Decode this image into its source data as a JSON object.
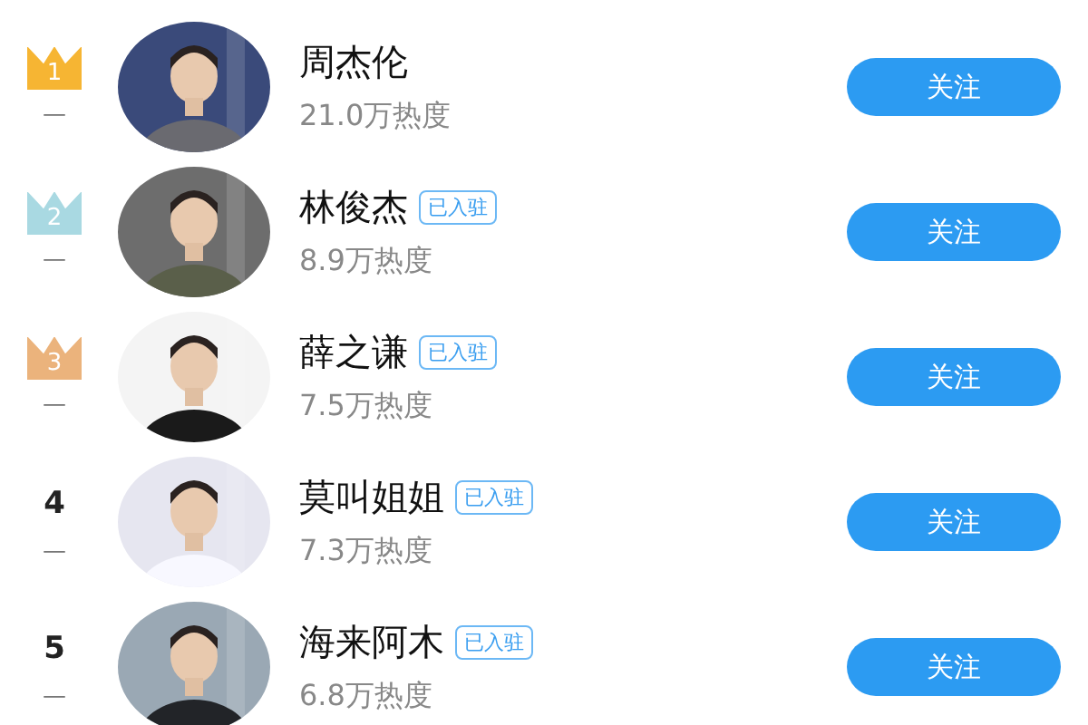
{
  "ranking": [
    {
      "rank": {
        "kind": "medal",
        "label": "1",
        "color": "#f6b533"
      },
      "trend": "—",
      "name": "周杰伦",
      "verified": false,
      "heat": "21.0万热度",
      "button": "关注"
    },
    {
      "rank": {
        "kind": "medal",
        "label": "2",
        "color": "#a9d9e2"
      },
      "trend": "—",
      "name": "林俊杰",
      "verified": true,
      "badge": "已入驻",
      "heat": "8.9万热度",
      "button": "关注"
    },
    {
      "rank": {
        "kind": "medal",
        "label": "3",
        "color": "#ebb37c"
      },
      "trend": "—",
      "name": "薛之谦",
      "verified": true,
      "badge": "已入驻",
      "heat": "7.5万热度",
      "button": "关注"
    },
    {
      "rank": {
        "kind": "number",
        "label": "4"
      },
      "trend": "—",
      "name": "莫叫姐姐",
      "verified": true,
      "badge": "已入驻",
      "heat": "7.3万热度",
      "button": "关注"
    },
    {
      "rank": {
        "kind": "number",
        "label": "5"
      },
      "trend": "—",
      "name": "海来阿木",
      "verified": true,
      "badge": "已入驻",
      "heat": "6.8万热度",
      "button": "关注"
    }
  ]
}
